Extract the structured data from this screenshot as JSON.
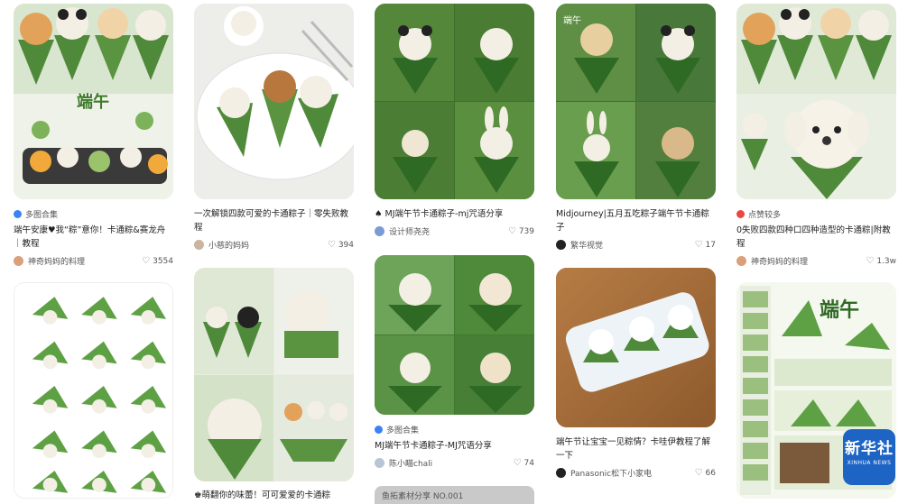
{
  "colors": {
    "leaf": "#4f8a3a",
    "leaf_dark": "#2f6a25",
    "rice": "#f3efe4",
    "bg_green": "#cfe3c1",
    "accent_blue": "#3b82f6"
  },
  "cards": [
    {
      "tag": "多图合集",
      "title": "端午安康♥我“粽”意你！卡通粽&赛龙舟｜教程",
      "author": "神奇妈妈的料理",
      "likes": "3554"
    },
    {
      "title": "一次解锁四款可爱的卡通粽子｜零失败教程",
      "author": "小慈的妈妈",
      "likes": "394"
    },
    {
      "title": "♠ MJ端午节卡通粽子-mj咒语分享",
      "author": "设计师尧尧",
      "likes": "739"
    },
    {
      "title": "Midjourney|五月五吃粽子端午节卡通粽子",
      "author": "繁华视觉",
      "likes": "17"
    },
    {
      "tag": "点赞较多",
      "title": "0失败四款四种口四种造型的卡通粽|附教程",
      "author": "神奇妈妈的料理",
      "likes": "1.3w"
    },
    {
      "title": "♚萌翻你的味蕾！可可爱爱的卡通粽"
    },
    {
      "tag": "多图合集",
      "title": "MJ端午节卡通粽子-MJ咒语分享",
      "author": "陈小瞄chali",
      "likes": "74"
    },
    {
      "title": "端午节让宝宝一见粽情？卡哇伊教程了解一下",
      "author": "Panasonic松下小家电",
      "likes": "66"
    }
  ],
  "strip_text": "鱼拓素材分享   NO.001",
  "logo": {
    "line1": "新华社",
    "line2": "XINHUA NEWS"
  },
  "poster_text": "端午"
}
